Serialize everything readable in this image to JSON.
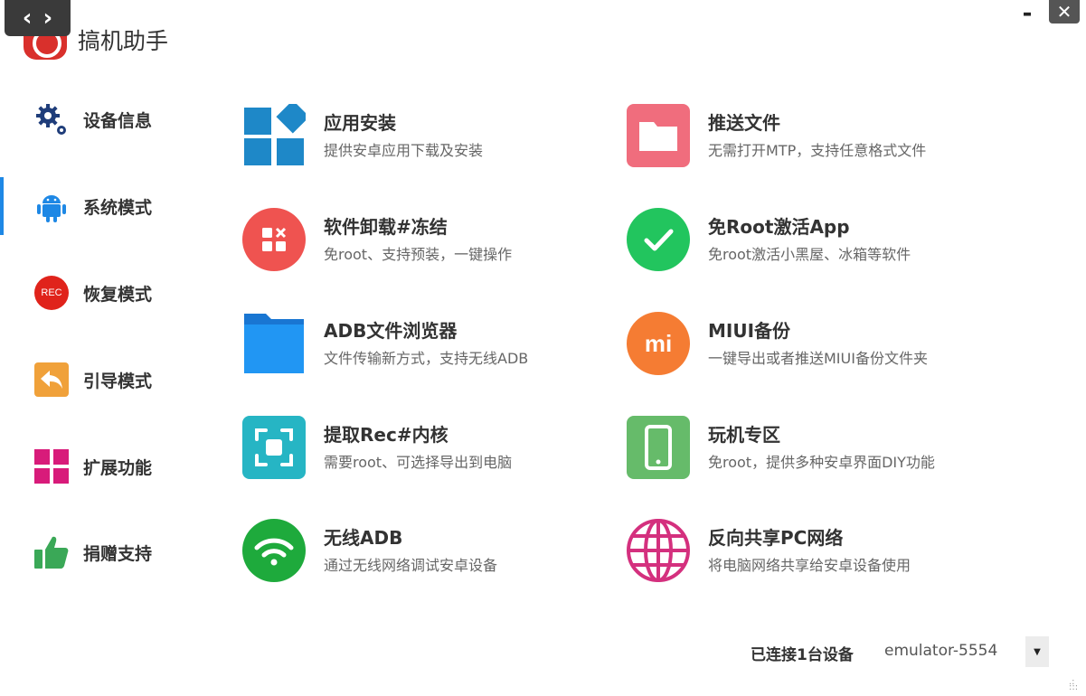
{
  "app": {
    "title": "搞机助手"
  },
  "sidebar": {
    "items": [
      {
        "label": "设备信息",
        "icon": "gear-icon"
      },
      {
        "label": "系统模式",
        "icon": "android-icon"
      },
      {
        "label": "恢复模式",
        "icon": "rec-icon",
        "badge": "REC"
      },
      {
        "label": "引导模式",
        "icon": "reply-arrow-icon"
      },
      {
        "label": "扩展功能",
        "icon": "grid-icon"
      },
      {
        "label": "捐赠支持",
        "icon": "thumbs-up-icon"
      }
    ],
    "active_index": 1
  },
  "features": [
    {
      "title": "应用安装",
      "desc": "提供安卓应用下载及安装",
      "icon": "app-grid-icon",
      "color": "#1e88c8"
    },
    {
      "title": "推送文件",
      "desc": "无需打开MTP，支持任意格式文件",
      "icon": "folder-icon",
      "color": "#f06d7d"
    },
    {
      "title": "软件卸载#冻结",
      "desc": "免root、支持预装，一键操作",
      "icon": "uninstall-icon",
      "color": "#ef5350"
    },
    {
      "title": "免Root激活App",
      "desc": "免root激活小黑屋、冰箱等软件",
      "icon": "check-icon",
      "color": "#22c55e"
    },
    {
      "title": "ADB文件浏览器",
      "desc": "文件传输新方式，支持无线ADB",
      "icon": "folder-browser-icon",
      "color": "#2196f3"
    },
    {
      "title": "MIUI备份",
      "desc": "一键导出或者推送MIUI备份文件夹",
      "icon": "mi-icon",
      "color": "#f57c33",
      "icon_text": "mi"
    },
    {
      "title": "提取Rec#内核",
      "desc": "需要root、可选择导出到电脑",
      "icon": "screenshot-icon",
      "color": "#26b5c4"
    },
    {
      "title": "玩机专区",
      "desc": "免root，提供多种安卓界面DIY功能",
      "icon": "phone-icon",
      "color": "#66bb6a"
    },
    {
      "title": "无线ADB",
      "desc": "通过无线网络调试安卓设备",
      "icon": "wifi-icon",
      "color": "#1eaa3c"
    },
    {
      "title": "反向共享PC网络",
      "desc": "将电脑网络共享给安卓设备使用",
      "icon": "globe-icon",
      "color": "#d4307e"
    }
  ],
  "status": {
    "label": "已连接1台设备",
    "device": "emulator-5554"
  },
  "colors": {
    "accent": "#1e88e5"
  }
}
